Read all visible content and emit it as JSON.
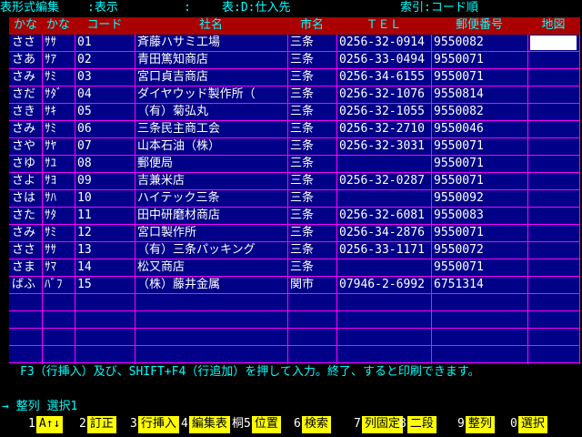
{
  "status": {
    "mode": "表形式編集",
    "view": ":表示",
    "colon": ":",
    "table": "表:D:仕入先",
    "index": "索引:コード順"
  },
  "columns": [
    "かな",
    "かな",
    "コード",
    "社名",
    "市名",
    "ＴＥＬ",
    "郵便番号",
    "地図"
  ],
  "rows": [
    [
      "ささ",
      "ｻｻ",
      "01",
      "斉藤ハサミ工場",
      "三条",
      "0256-32-0914",
      "9550082",
      ""
    ],
    [
      "さあ",
      "ｻｱ",
      "02",
      "青田篤知商店",
      "三条",
      "0256-33-0494",
      "9550071",
      ""
    ],
    [
      "さみ",
      "ｻﾐ",
      "03",
      "宮口貞吉商店",
      "三条",
      "0256-34-6155",
      "9550071",
      ""
    ],
    [
      "さだ",
      "ｻﾀﾞ",
      "04",
      "ダイヤウッド製作所（",
      "三条",
      "0256-32-1076",
      "9550814",
      ""
    ],
    [
      "さき",
      "ｻｷ",
      "05",
      "（有）菊弘丸",
      "三条",
      "0256-32-1055",
      "9550082",
      ""
    ],
    [
      "さみ",
      "ｻﾐ",
      "06",
      "三条民主商工会",
      "三条",
      "0256-32-2710",
      "9550046",
      ""
    ],
    [
      "さや",
      "ｻﾔ",
      "07",
      "山本石油（株）",
      "三条",
      "0256-32-3031",
      "9550071",
      ""
    ],
    [
      "さゆ",
      "ｻﾕ",
      "08",
      "郵便局",
      "三条",
      "",
      "9550071",
      ""
    ],
    [
      "さよ",
      "ｻﾖ",
      "09",
      "吉兼米店",
      "三条",
      "0256-32-0287",
      "9550071",
      ""
    ],
    [
      "さは",
      "ｻﾊ",
      "10",
      "ハイテック三条",
      "三条",
      "",
      "9550092",
      ""
    ],
    [
      "さた",
      "ｻﾀ",
      "11",
      "田中研磨材商店",
      "三条",
      "0256-32-6081",
      "9550083",
      ""
    ],
    [
      "さみ",
      "ｻﾐ",
      "12",
      "宮口製作所",
      "三条",
      "0256-34-2876",
      "9550071",
      ""
    ],
    [
      "ささ",
      "ｻｻ",
      "13",
      "（有）三条パッキング",
      "三条",
      "0256-33-1171",
      "9550072",
      ""
    ],
    [
      "さま",
      "ｻﾏ",
      "14",
      "松又商店",
      "三条",
      "",
      "9550071",
      ""
    ],
    [
      "ばふ",
      "ﾊﾞﾌ",
      "15",
      "（株）藤井金属",
      "関市",
      "07946-2-6992",
      "6751314",
      ""
    ]
  ],
  "hint": "F3（行挿入）及び、SHIFT+F4（行追加）を押して入力。終了、すると印刷できます。",
  "command_line": "→ 整列 選択1",
  "fkeys": [
    {
      "num": "1",
      "label": "A↑↓"
    },
    {
      "num": "2",
      "label": "訂正"
    },
    {
      "num": "3",
      "label": "行挿入"
    },
    {
      "num": "4",
      "label": "編集表"
    },
    {
      "num": "桐5",
      "label": "位置"
    },
    {
      "num": "6",
      "label": "検索"
    },
    {
      "num": "7",
      "label": "列固定"
    },
    {
      "num": "8",
      "label": "二段"
    },
    {
      "num": "9",
      "label": "整列"
    },
    {
      "num": "0",
      "label": "選択"
    }
  ],
  "colors": {
    "table_bg": "#000088",
    "header_bg": "#aa0000",
    "grid": "#ff00ff",
    "accent": "#00ffff",
    "fkey": "#ffff00"
  }
}
